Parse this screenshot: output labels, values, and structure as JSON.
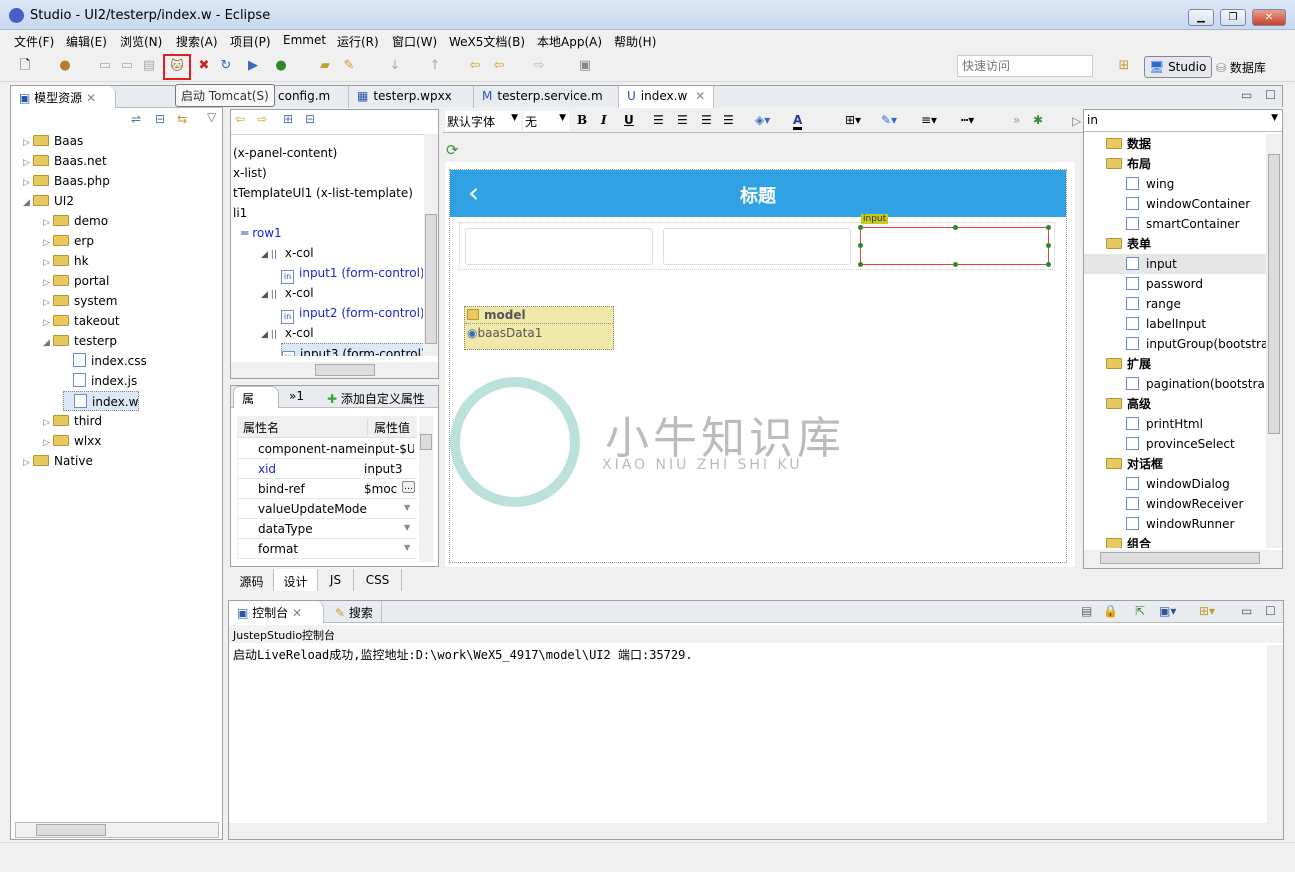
{
  "window": {
    "title": "Studio - UI2/testerp/index.w - Eclipse",
    "minimize": "▁",
    "restore": "❐",
    "close": "✕"
  },
  "menu": [
    "文件(F)",
    "编辑(E)",
    "浏览(N)",
    "搜索(A)",
    "项目(P)",
    "Emmet",
    "运行(R)",
    "窗口(W)",
    "WeX5文档(B)",
    "本地App(A)",
    "帮助(H)"
  ],
  "toolbar": {
    "tooltip": "启动 Tomcat(S)",
    "quick_access_placeholder": "快速访问",
    "perspective_studio": "Studio",
    "perspective_db": "数据库"
  },
  "left_panel": {
    "tab": "模型资源",
    "tree": [
      {
        "label": "Baas",
        "level": 0,
        "type": "folder",
        "arrow": "▷"
      },
      {
        "label": "Baas.net",
        "level": 0,
        "type": "folder",
        "arrow": "▷"
      },
      {
        "label": "Baas.php",
        "level": 0,
        "type": "folder",
        "arrow": "▷"
      },
      {
        "label": "UI2",
        "level": 0,
        "type": "folder",
        "arrow": "◢"
      },
      {
        "label": "demo",
        "level": 1,
        "type": "folder",
        "arrow": "▷"
      },
      {
        "label": "erp",
        "level": 1,
        "type": "folder",
        "arrow": "▷"
      },
      {
        "label": "hk",
        "level": 1,
        "type": "folder",
        "arrow": "▷"
      },
      {
        "label": "portal",
        "level": 1,
        "type": "folder",
        "arrow": "▷"
      },
      {
        "label": "system",
        "level": 1,
        "type": "folder",
        "arrow": "▷"
      },
      {
        "label": "takeout",
        "level": 1,
        "type": "folder",
        "arrow": "▷"
      },
      {
        "label": "testerp",
        "level": 1,
        "type": "folder",
        "arrow": "◢"
      },
      {
        "label": "index.css",
        "level": 2,
        "type": "file",
        "arrow": ""
      },
      {
        "label": "index.js",
        "level": 2,
        "type": "file",
        "arrow": ""
      },
      {
        "label": "index.w",
        "level": 2,
        "type": "file",
        "arrow": "",
        "selected": true
      },
      {
        "label": "third",
        "level": 1,
        "type": "folder",
        "arrow": "▷"
      },
      {
        "label": "wlxx",
        "level": 1,
        "type": "folder",
        "arrow": "▷"
      },
      {
        "label": "Native",
        "level": 0,
        "type": "folder",
        "arrow": "▷"
      }
    ]
  },
  "editor_tabs": [
    {
      "label": "config.m",
      "icon": ""
    },
    {
      "label": "testerp.wpxx",
      "icon": "▦"
    },
    {
      "label": "testerp.service.m",
      "icon": "M"
    },
    {
      "label": "index.w",
      "icon": "U",
      "active": true
    }
  ],
  "outline": [
    {
      "label": "(x-panel-content)",
      "indent": 0
    },
    {
      "label": "x-list)",
      "indent": 0
    },
    {
      "label": "tTemplateUl1 (x-list-template)",
      "indent": 0
    },
    {
      "label": "li1",
      "indent": 0
    },
    {
      "label": "row1",
      "indent": 1,
      "blue": true
    },
    {
      "label": "x-col",
      "indent": 2
    },
    {
      "label": "input1 (form-control)",
      "indent": 3,
      "blue": true
    },
    {
      "label": "x-col",
      "indent": 2
    },
    {
      "label": "input2 (form-control)",
      "indent": 3,
      "blue": true
    },
    {
      "label": "x-col",
      "indent": 2
    },
    {
      "label": "input3 (form-control)",
      "indent": 3,
      "selected": true
    }
  ],
  "properties": {
    "tabs": [
      "属",
      "»1"
    ],
    "add_custom": "添加自定义属性",
    "col_name": "属性名",
    "col_value": "属性值",
    "rows": [
      {
        "name": "component-name",
        "value": "input-$U"
      },
      {
        "name": "xid",
        "value": "input3",
        "blue": true
      },
      {
        "name": "bind-ref",
        "value": "$moc"
      },
      {
        "name": "valueUpdateMode",
        "value": ""
      },
      {
        "name": "dataType",
        "value": ""
      },
      {
        "name": "format",
        "value": ""
      }
    ]
  },
  "format_bar": {
    "font": "默认字体",
    "size": "无",
    "bold": "B",
    "italic": "I",
    "underline": "U"
  },
  "design": {
    "header_title": "标题",
    "back": "‹",
    "input_label": "input",
    "model_label": "model",
    "model_item": "baasData1",
    "header_color": "#30a2e4"
  },
  "watermark": {
    "cn": "小牛知识库",
    "en": "XIAO NIU ZHI SHI KU"
  },
  "palette": {
    "search": "in",
    "items": [
      {
        "label": "数据",
        "group": true
      },
      {
        "label": "布局",
        "group": true
      },
      {
        "label": "wing"
      },
      {
        "label": "windowContainer"
      },
      {
        "label": "smartContainer"
      },
      {
        "label": "表单",
        "group": true
      },
      {
        "label": "input",
        "selected": true
      },
      {
        "label": "password"
      },
      {
        "label": "range"
      },
      {
        "label": "labelInput"
      },
      {
        "label": "inputGroup(bootstra"
      },
      {
        "label": "扩展",
        "group": true
      },
      {
        "label": "pagination(bootstra"
      },
      {
        "label": "高级",
        "group": true
      },
      {
        "label": "printHtml"
      },
      {
        "label": "provinceSelect"
      },
      {
        "label": "对话框",
        "group": true
      },
      {
        "label": "windowDialog"
      },
      {
        "label": "windowReceiver"
      },
      {
        "label": "windowRunner"
      },
      {
        "label": "组合",
        "group": true
      }
    ]
  },
  "bottom_tabs": [
    "源码",
    "设计",
    "JS",
    "CSS"
  ],
  "console": {
    "tabs": [
      "控制台",
      "搜索"
    ],
    "title": "JustepStudio控制台",
    "text": "启动LiveReload成功,监控地址:D:\\work\\WeX5_4917\\model\\UI2 端口:35729."
  }
}
